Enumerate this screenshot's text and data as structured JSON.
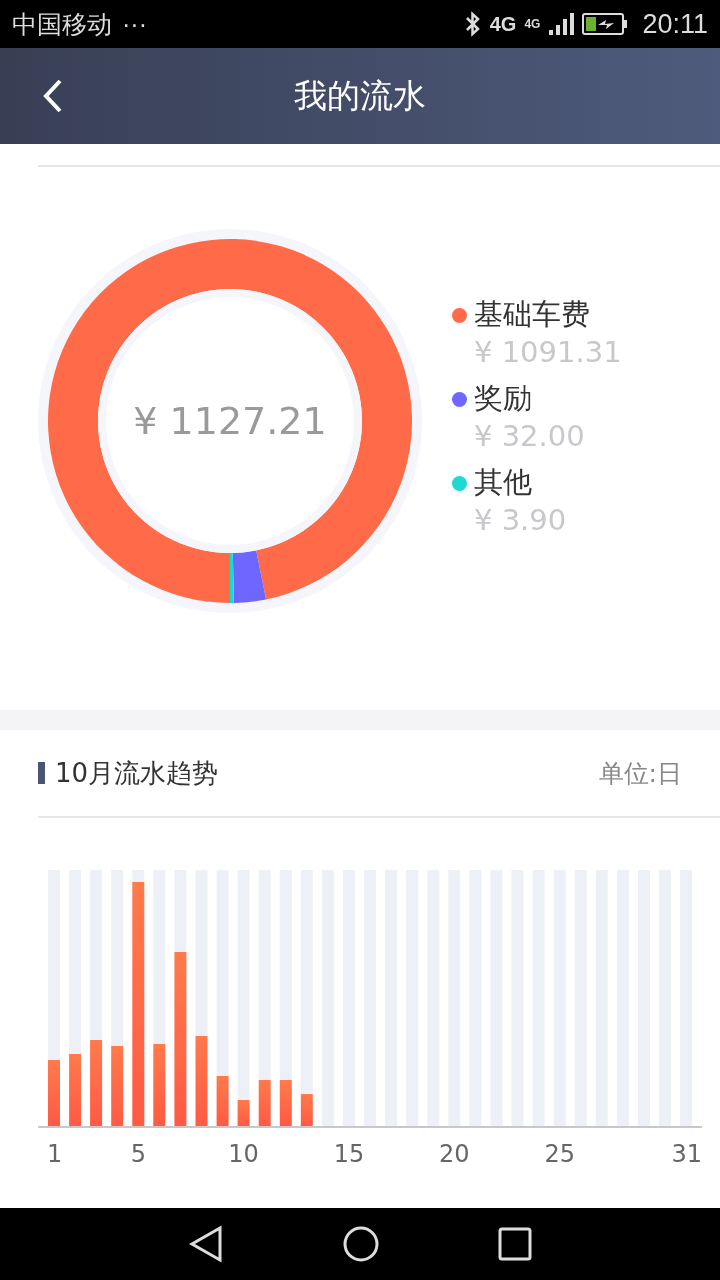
{
  "status_bar": {
    "carrier": "中国移动",
    "more": "···",
    "network": "4G",
    "signal_network": "4G",
    "time": "20:11"
  },
  "header": {
    "title": "我的流水"
  },
  "summary": {
    "total": "¥ 1127.21",
    "legend": [
      {
        "amount": "¥ 1091.31",
        "color": "#ff6a48"
      },
      {
        "amount": "¥ 32.00",
        "color": "#6f66ff"
      },
      {
        "amount": "¥ 3.90",
        "color": "#1fd8d2"
      }
    ],
    "chart_data": {
      "type": "donut",
      "categories": [
        "基础车费",
        "奖励",
        "其他"
      ],
      "values": [
        96.82,
        2.84,
        0.34
      ]
    }
  },
  "trend": {
    "title": "10月流水趋势",
    "unit": "单位:日",
    "x_labels": [
      "1",
      "5",
      "10",
      "15",
      "20",
      "25",
      "31"
    ]
  }
}
